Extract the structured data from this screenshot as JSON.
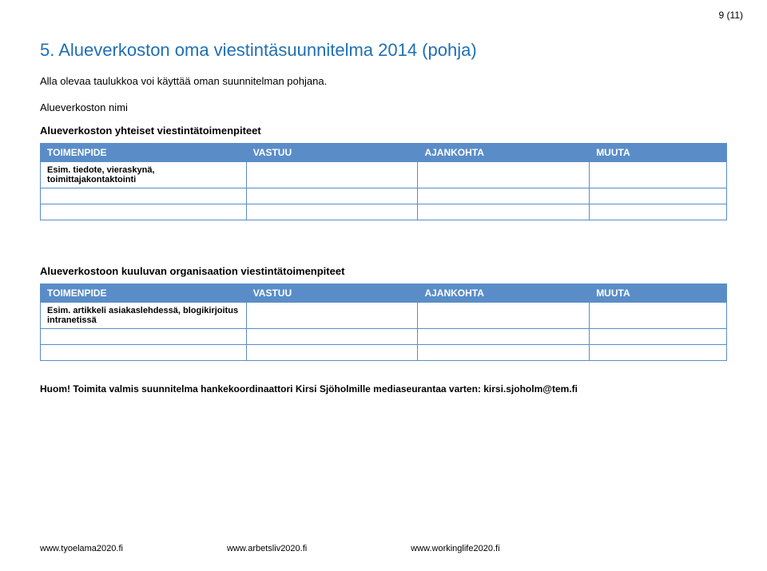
{
  "page_number": "9 (11)",
  "heading": "5. Alueverkoston oma viestintäsuunnitelma 2014 (pohja)",
  "intro": "Alla olevaa taulukkoa voi käyttää oman suunnitelman pohjana.",
  "label_nimi": "Alueverkoston nimi",
  "table1": {
    "title": "Alueverkoston yhteiset viestintätoimenpiteet",
    "headers": {
      "toimenpide": "TOIMENPIDE",
      "vastuu": "VASTUU",
      "ajankohta": "AJANKOHTA",
      "muuta": "MUUTA"
    },
    "rows": [
      {
        "toimenpide": "Esim. tiedote, vieraskynä, toimittajakontaktointi",
        "vastuu": "",
        "ajankohta": "",
        "muuta": ""
      },
      {
        "toimenpide": "",
        "vastuu": "",
        "ajankohta": "",
        "muuta": ""
      },
      {
        "toimenpide": "",
        "vastuu": "",
        "ajankohta": "",
        "muuta": ""
      }
    ]
  },
  "table2": {
    "title": "Alueverkostoon kuuluvan organisaation viestintätoimenpiteet",
    "headers": {
      "toimenpide": "TOIMENPIDE",
      "vastuu": "VASTUU",
      "ajankohta": "AJANKOHTA",
      "muuta": "MUUTA"
    },
    "rows": [
      {
        "toimenpide": "Esim. artikkeli asiakaslehdessä, blogikirjoitus intranetissä",
        "vastuu": "",
        "ajankohta": "",
        "muuta": ""
      },
      {
        "toimenpide": "",
        "vastuu": "",
        "ajankohta": "",
        "muuta": ""
      },
      {
        "toimenpide": "",
        "vastuu": "",
        "ajankohta": "",
        "muuta": ""
      }
    ]
  },
  "note": "Huom! Toimita valmis suunnitelma hankekoordinaattori Kirsi Sjöholmille mediaseurantaa varten: kirsi.sjoholm@tem.fi",
  "footer": {
    "link1": "www.tyoelama2020.fi",
    "link2": "www.arbetsliv2020.fi",
    "link3": "www.workinglife2020.fi"
  }
}
